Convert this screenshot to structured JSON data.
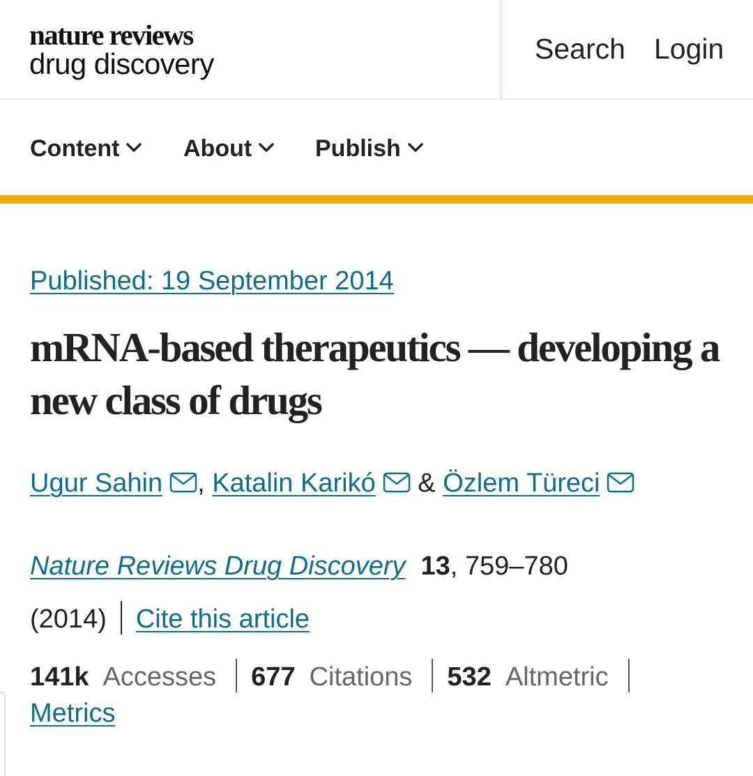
{
  "header": {
    "logo_line1": "nature reviews",
    "logo_line2": "drug discovery",
    "search_label": "Search",
    "login_label": "Login"
  },
  "nav": {
    "items": [
      {
        "label": "Content",
        "icon": "chevron-down-icon"
      },
      {
        "label": "About",
        "icon": "chevron-down-icon"
      },
      {
        "label": "Publish",
        "icon": "chevron-down-icon"
      }
    ]
  },
  "article": {
    "published": "Published: 19 September 2014",
    "title": "mRNA-based therapeutics — developing a new class of drugs",
    "authors": [
      {
        "name": "Ugur Sahin",
        "icon": "mail-icon"
      },
      {
        "name": "Katalin Karikó",
        "icon": "mail-icon"
      },
      {
        "name": "Özlem Türeci",
        "icon": "mail-icon"
      }
    ],
    "author_separators": [
      ",",
      "&"
    ],
    "journal": "Nature Reviews Drug Discovery",
    "volume": "13",
    "pages": ", 759–780",
    "year": "(2014)",
    "cite_label": "Cite this article"
  },
  "metrics": {
    "accesses_value": "141k",
    "accesses_label": "Accesses",
    "citations_value": "677",
    "citations_label": "Citations",
    "altmetric_value": "532",
    "altmetric_label": "Altmetric",
    "metrics_link": "Metrics"
  },
  "colors": {
    "accent_bar": "#f1a80f",
    "link": "#0e6c8d",
    "text": "#222222",
    "muted": "#666666"
  }
}
